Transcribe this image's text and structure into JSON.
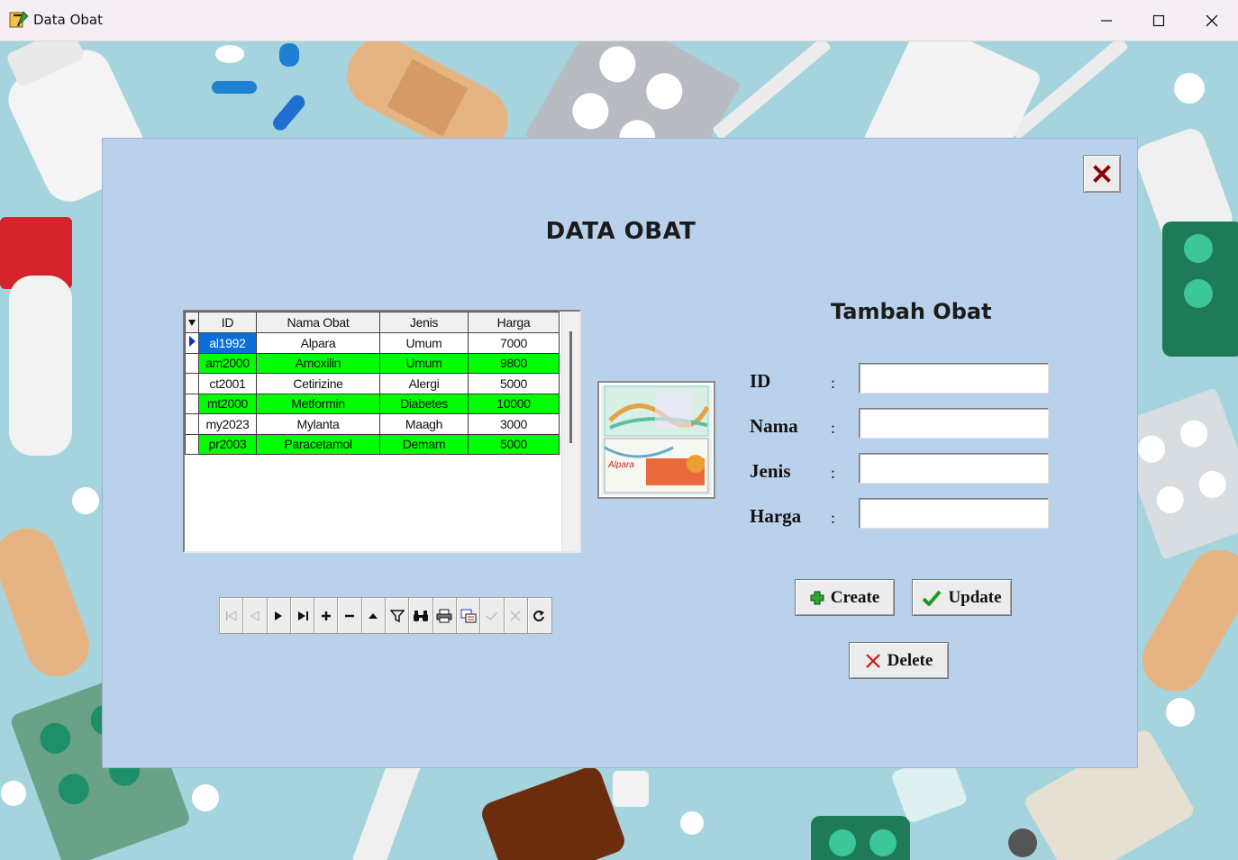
{
  "window": {
    "title": "Data Obat"
  },
  "panel": {
    "heading": "DATA OBAT",
    "form_heading": "Tambah Obat"
  },
  "grid": {
    "columns": [
      "ID",
      "Nama Obat",
      "Jenis",
      "Harga"
    ],
    "rows": [
      {
        "id": "al1992",
        "nama": "Alpara",
        "jenis": "Umum",
        "harga": "7000"
      },
      {
        "id": "am2000",
        "nama": "Amoxilin",
        "jenis": "Umum",
        "harga": "9800"
      },
      {
        "id": "ct2001",
        "nama": "Cetirizine",
        "jenis": "Alergi",
        "harga": "5000"
      },
      {
        "id": "mt2000",
        "nama": "Metformin",
        "jenis": "Diabetes",
        "harga": "10000"
      },
      {
        "id": "my2023",
        "nama": "Mylanta",
        "jenis": "Maagh",
        "harga": "3000"
      },
      {
        "id": "pr2003",
        "nama": "Paracetamol",
        "jenis": "Demam",
        "harga": "5000"
      }
    ],
    "selected_row": 0,
    "highlight_color": "#00ff00"
  },
  "image": {
    "brand_text": "Alpara"
  },
  "form": {
    "fields": [
      {
        "label": "ID",
        "colon": ":",
        "value": ""
      },
      {
        "label": "Nama",
        "colon": ":",
        "value": ""
      },
      {
        "label": "Jenis",
        "colon": ":",
        "value": ""
      },
      {
        "label": "Harga",
        "colon": ":",
        "value": ""
      }
    ]
  },
  "buttons": {
    "create": "Create",
    "update": "Update",
    "delete": "Delete"
  },
  "navigator": {
    "buttons": [
      "first-icon",
      "prior-icon",
      "next-icon",
      "last-icon",
      "insert-icon",
      "delete-icon",
      "edit-icon",
      "filter-icon",
      "search-icon",
      "print-icon",
      "export-icon",
      "post-icon",
      "cancel-icon",
      "refresh-icon"
    ]
  },
  "colors": {
    "panel": "#bad1ec",
    "selection": "#0a6fd8",
    "accent_red": "#8b0000"
  }
}
